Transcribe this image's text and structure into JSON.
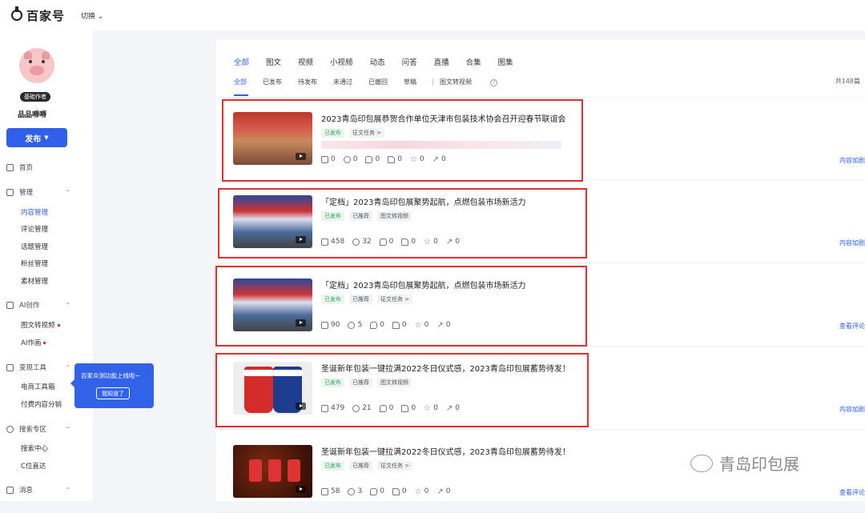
{
  "topbar": {
    "brand": "百家号",
    "switch_label": "切换"
  },
  "profile": {
    "badge": "基础作者",
    "name": "品品嘚嘚",
    "publish_label": "发布"
  },
  "nav": {
    "home": "首页",
    "manage": "管理",
    "manage_items": [
      "内容管理",
      "评论管理",
      "话题管理",
      "粉丝管理",
      "素材管理"
    ],
    "ai": "AI创作",
    "ai_items": [
      "图文转视频",
      "AI作画"
    ],
    "monetize": "变现工具",
    "monetize_items": [
      "电商工具箱",
      "付费内容分销"
    ],
    "search": "搜索专区",
    "search_items": [
      "搜索中心",
      "C位直达"
    ],
    "messages": "消息"
  },
  "tooltip": {
    "text": "百家众测功能上线啦~",
    "button": "我知道了"
  },
  "tabs_primary": [
    "全部",
    "图文",
    "视频",
    "小视频",
    "动态",
    "问答",
    "直播",
    "合集",
    "图集"
  ],
  "tabs_secondary": [
    "全部",
    "已发布",
    "待发布",
    "未通过",
    "已撤回",
    "草稿"
  ],
  "tabs_secondary_extra": "图文转视频",
  "total": "共148篇",
  "articles": [
    {
      "title": "2023青岛印包展恭贺合作单位天津市包装技术协会召开迎春节联谊会",
      "tags": [
        "已发布",
        "征文任务 >"
      ],
      "stats": [
        "0",
        "0",
        "0",
        "0",
        "0",
        "0"
      ],
      "link": "内容加剧"
    },
    {
      "title": "「定档」2023青岛印包展聚势起航，点燃包装市场新活力",
      "tags": [
        "已发布",
        "已推荐",
        "图文转视频"
      ],
      "stats": [
        "458",
        "32",
        "0",
        "0",
        "0",
        "0"
      ],
      "link": "内容加剧"
    },
    {
      "title": "「定档」2023青岛印包展聚势起航，点燃包装市场新活力",
      "tags": [
        "已发布",
        "已推荐",
        "征文任务 >"
      ],
      "stats": [
        "90",
        "5",
        "0",
        "0",
        "0",
        "0"
      ],
      "link": "查看评论"
    },
    {
      "title": "圣诞新年包装一键拉满2022冬日仪式感，2023青岛印包展蓄势待发！",
      "tags": [
        "已发布",
        "已推荐",
        "图文转视频"
      ],
      "stats": [
        "479",
        "21",
        "0",
        "0",
        "0",
        "0"
      ],
      "link": "内容加剧"
    },
    {
      "title": "圣诞新年包装一键拉满2022冬日仪式感，2023青岛印包展蓄势待发！",
      "tags": [
        "已发布",
        "已推荐",
        "征文任务 >"
      ],
      "stats": [
        "58",
        "3",
        "0",
        "0",
        "0",
        "0"
      ],
      "link": "查看评论"
    }
  ],
  "watermark": "青岛印包展",
  "colors": {
    "accent": "#3060e8",
    "highlight": "#e23030",
    "published": "#2aa45a"
  }
}
